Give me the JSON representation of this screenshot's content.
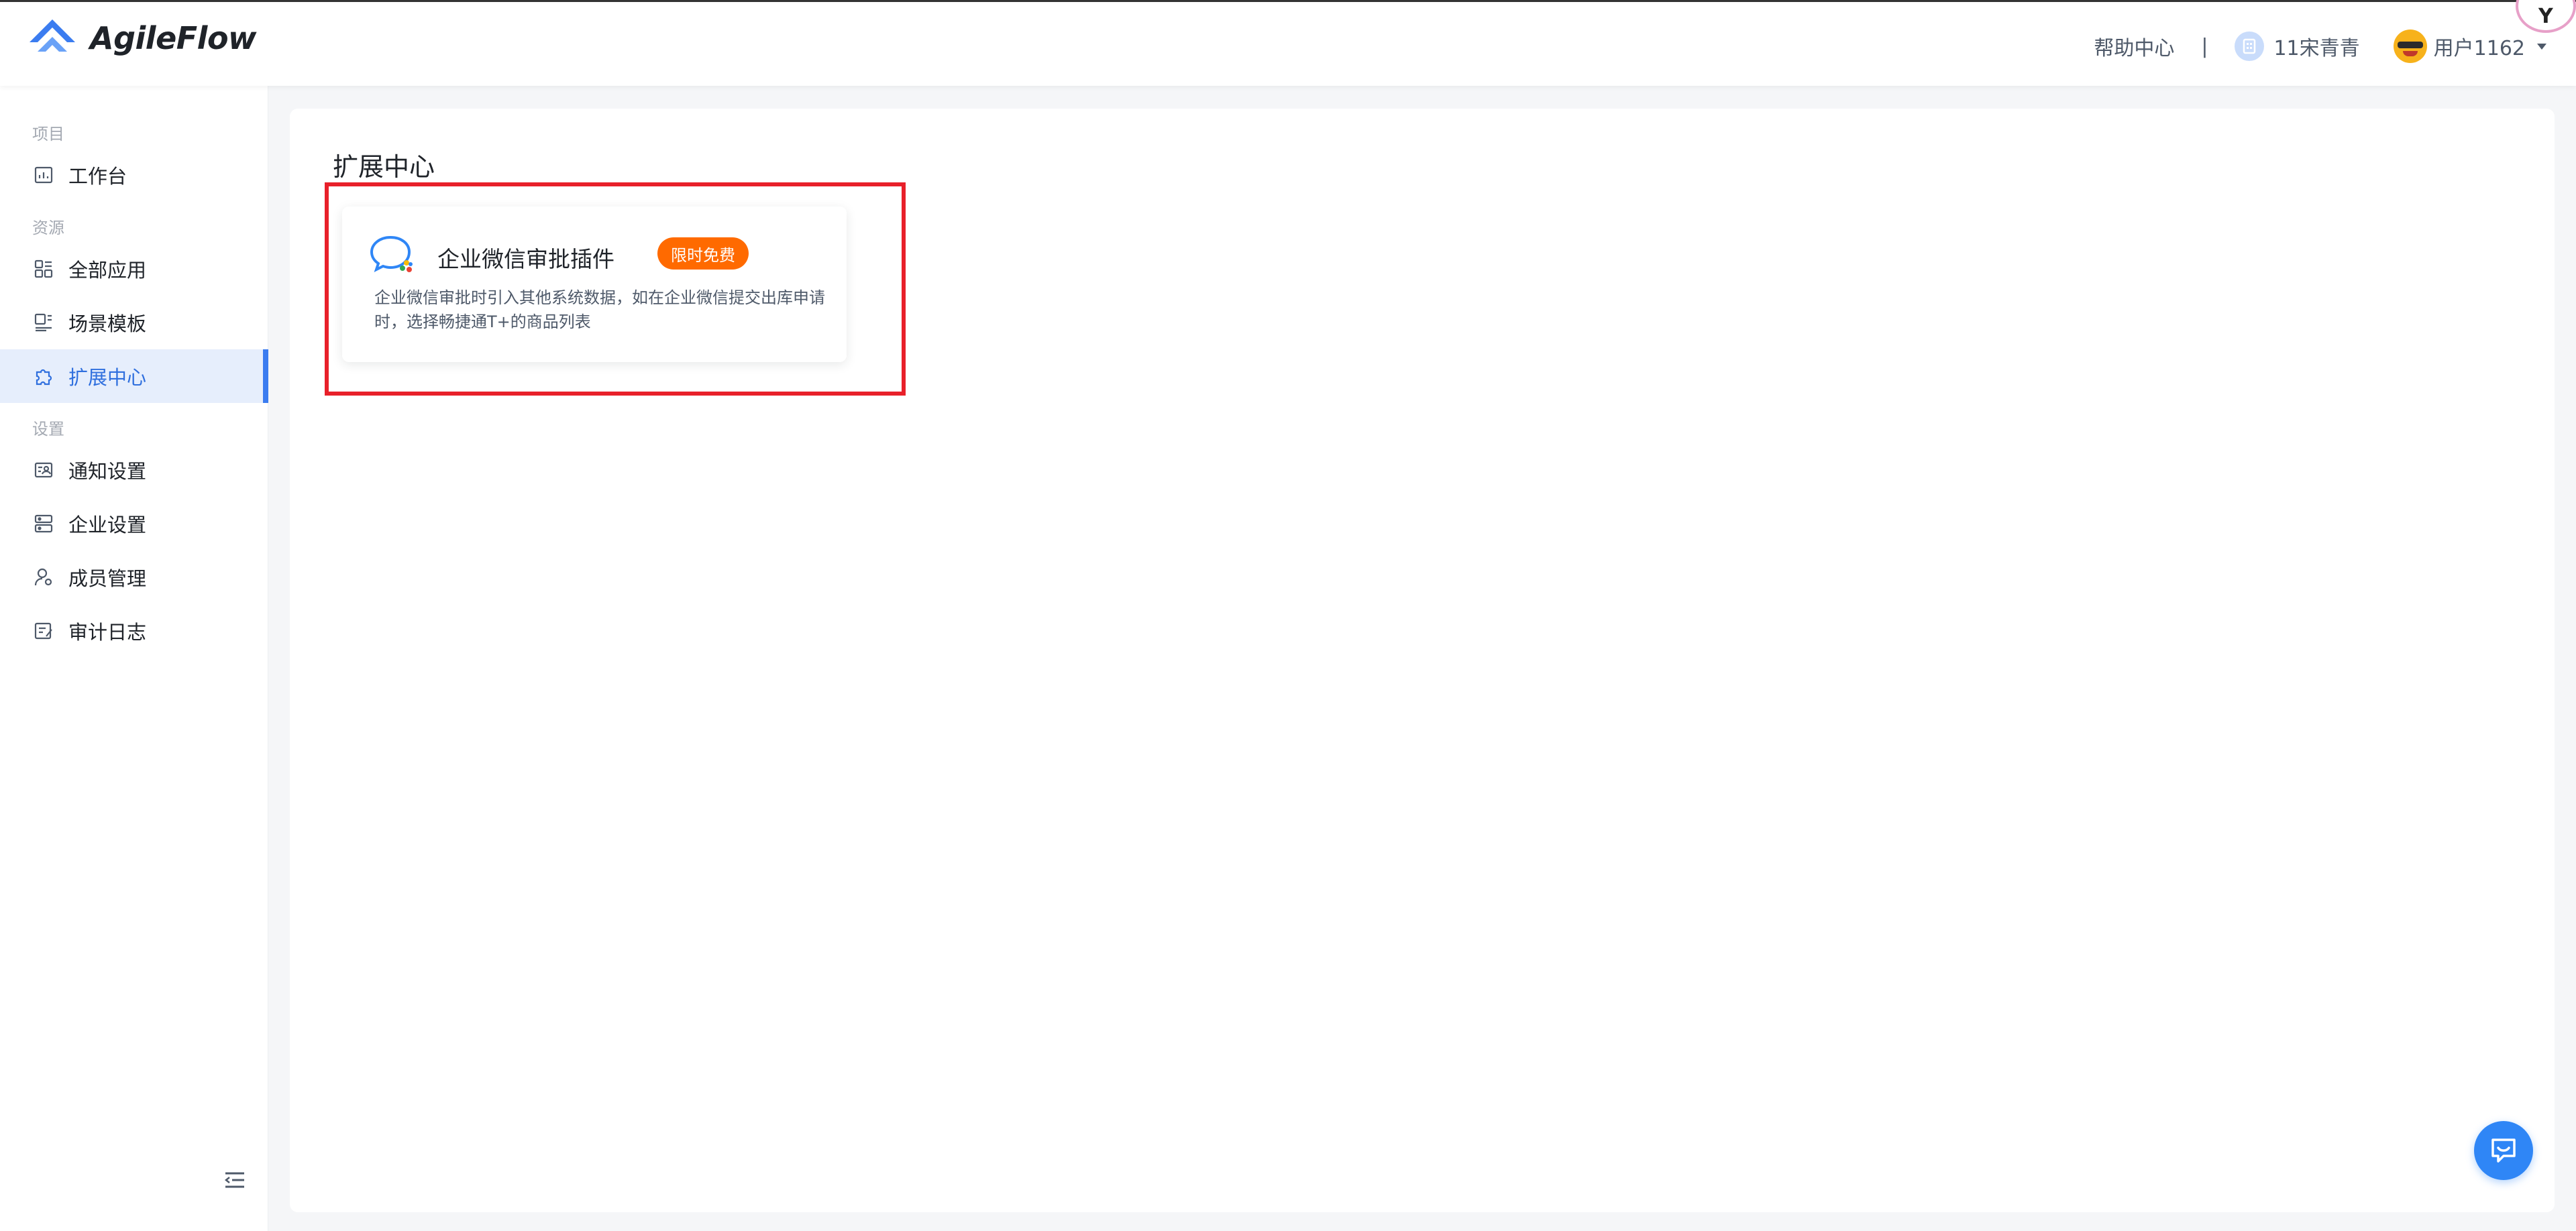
{
  "app": {
    "logo_text": "AgileFlow",
    "brand_color": "#3b7cf0"
  },
  "header": {
    "help_label": "帮助中心",
    "separator": "|",
    "org_name": "11宋青青",
    "user_name": "用户1162"
  },
  "sidebar": {
    "groups": [
      {
        "label": "项目"
      },
      {
        "label": "资源"
      },
      {
        "label": "设置"
      }
    ],
    "items": [
      {
        "label": "工作台",
        "icon": "dashboard-icon",
        "active": false
      },
      {
        "label": "全部应用",
        "icon": "apps-grid-icon",
        "active": false
      },
      {
        "label": "场景模板",
        "icon": "template-icon",
        "active": false
      },
      {
        "label": "扩展中心",
        "icon": "puzzle-icon",
        "active": true
      },
      {
        "label": "通知设置",
        "icon": "notification-settings-icon",
        "active": false
      },
      {
        "label": "企业设置",
        "icon": "enterprise-settings-icon",
        "active": false
      },
      {
        "label": "成员管理",
        "icon": "member-icon",
        "active": false
      },
      {
        "label": "审计日志",
        "icon": "audit-log-icon",
        "active": false
      }
    ],
    "collapse_icon": "collapse-menu-icon"
  },
  "main": {
    "title": "扩展中心",
    "plugins": [
      {
        "title": "企业微信审批插件",
        "badge": "限时免费",
        "badge_color": "#ff6a00",
        "icon": "wecom-chat-icon",
        "description": "企业微信审批时引入其他系统数据，如在企业微信提交出库申请时，选择畅捷通T+的商品列表"
      }
    ]
  },
  "floating": {
    "chat_icon": "chat-support-icon"
  }
}
